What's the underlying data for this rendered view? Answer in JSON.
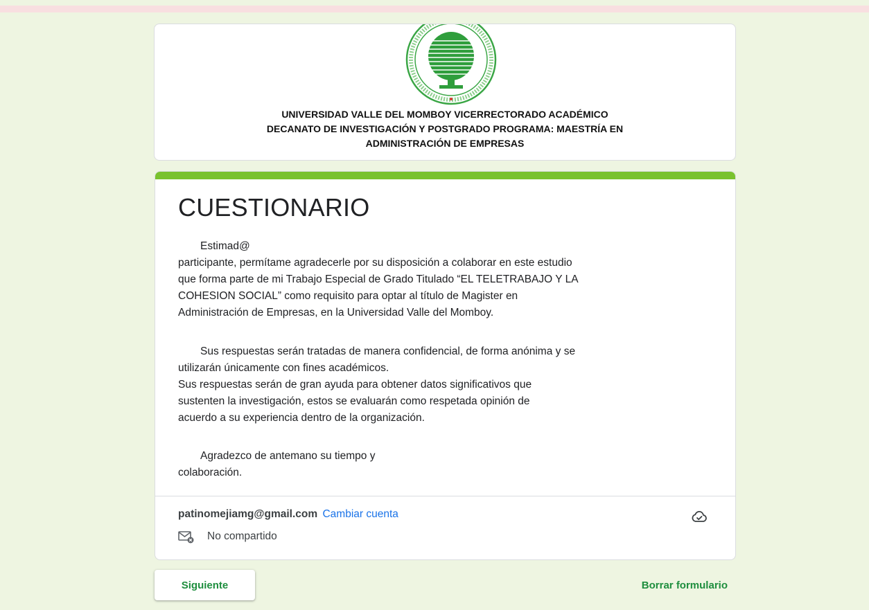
{
  "colors": {
    "page_background": "#eef5e1",
    "accent": "#79c22e",
    "link": "#1a73e8",
    "button_text": "#1e8e3e"
  },
  "header": {
    "logo_icon": "university-seal-icon",
    "lines": [
      "UNIVERSIDAD VALLE DEL MOMBOY VICERRECTORADO ACADÉMICO",
      "DECANATO DE INVESTIGACIÓN Y POSTGRADO PROGRAMA: MAESTRÍA EN",
      "ADMINISTRACIÓN DE EMPRESAS"
    ]
  },
  "form": {
    "title": "CUESTIONARIO",
    "paragraph1": [
      "Estimad@",
      "participante, permítame agradecerle por su disposición a colaborar en este estudio",
      "que forma parte de mi Trabajo Especial de Grado Titulado “EL TELETRABAJO Y LA",
      "COHESION SOCIAL” como requisito para optar al título de Magister en",
      "Administración de Empresas, en la Universidad Valle del Momboy."
    ],
    "paragraph2": [
      "Sus respuestas serán tratadas de manera confidencial, de forma anónima y se",
      "utilizarán únicamente con fines académicos.",
      "Sus respuestas serán de gran ayuda para obtener datos significativos que",
      "sustenten la investigación, estos se evaluarán como respetada opinión de",
      "acuerdo a su experiencia dentro de la organización."
    ],
    "paragraph3": [
      "Agradezco de antemano su tiempo y",
      "colaboración."
    ]
  },
  "account": {
    "email": "patinomejiamg@gmail.com",
    "switch_label": "Cambiar cuenta",
    "shared_status": "No compartido",
    "cloud_icon": "cloud-check-icon",
    "mail_icon": "mail-not-shared-icon"
  },
  "actions": {
    "next_label": "Siguiente",
    "clear_label": "Borrar formulario"
  }
}
